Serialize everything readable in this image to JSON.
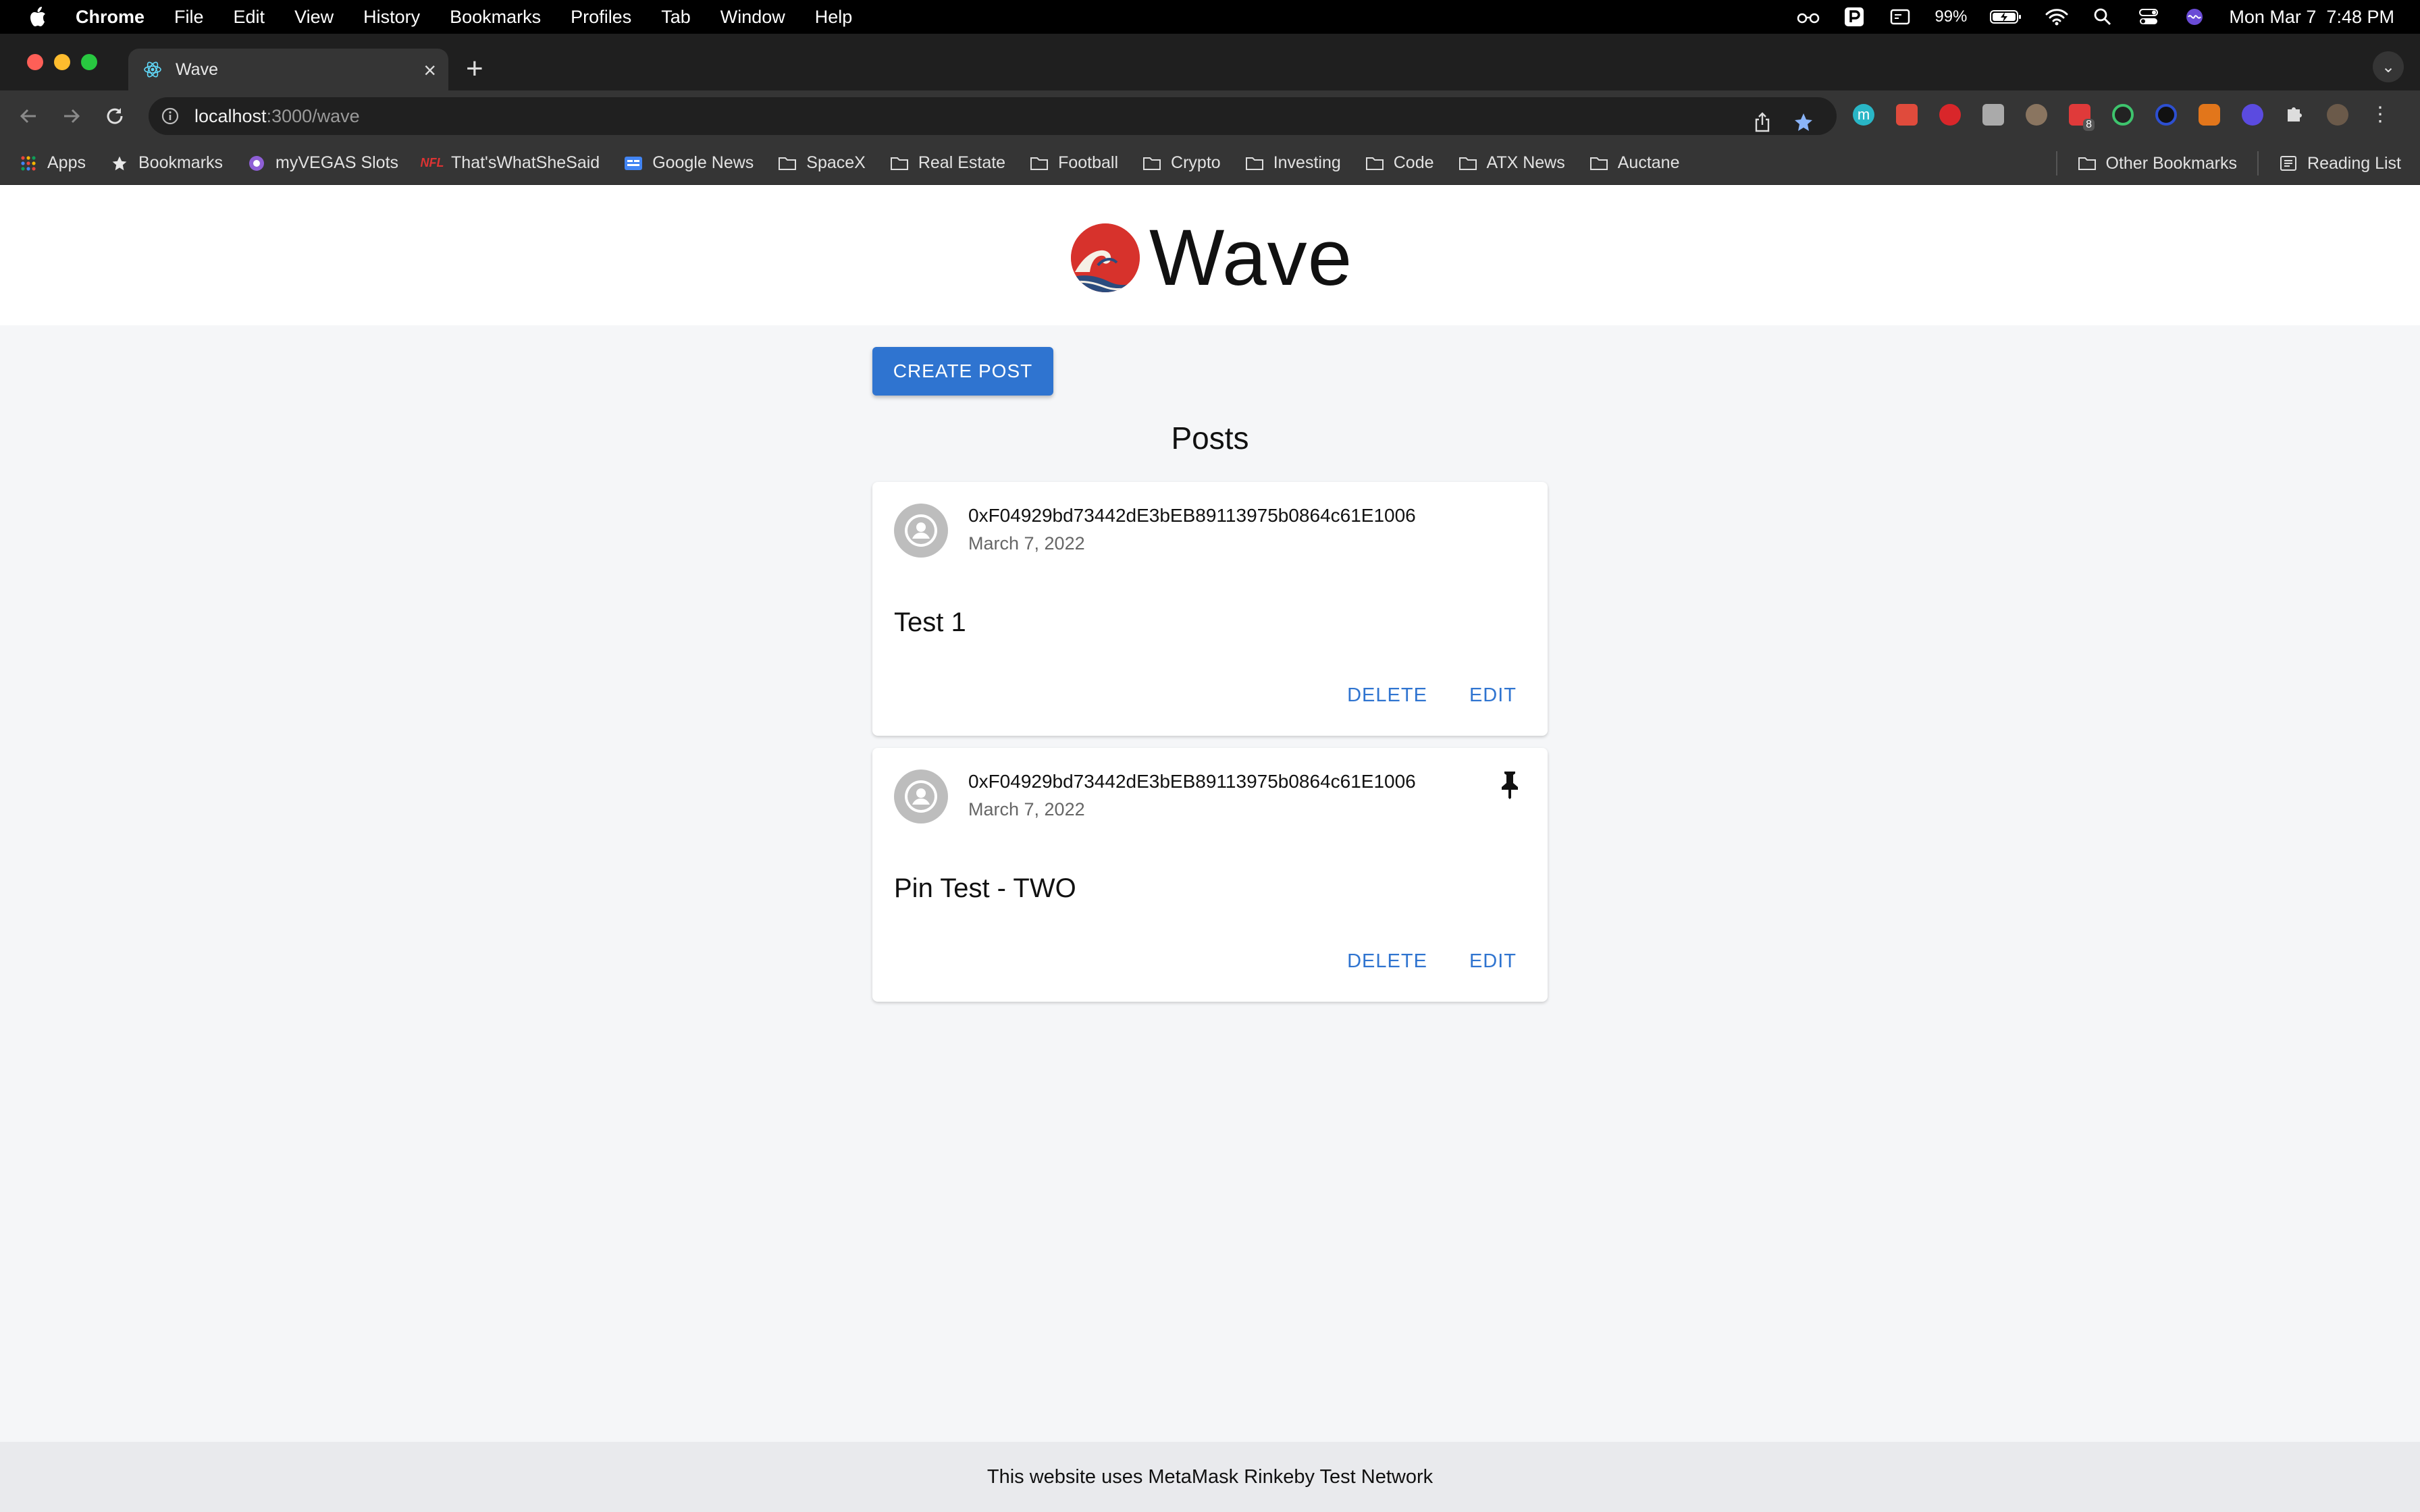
{
  "menubar": {
    "app": "Chrome",
    "items": [
      "File",
      "Edit",
      "View",
      "History",
      "Bookmarks",
      "Profiles",
      "Tab",
      "Window",
      "Help"
    ],
    "battery": "99%",
    "clock": "Mon Mar 7  7:48 PM"
  },
  "browser": {
    "tab_title": "Wave",
    "url_host": "localhost",
    "url_path": ":3000/wave",
    "bookmarks": [
      "Apps",
      "Bookmarks",
      "myVEGAS Slots",
      "That'sWhatSheSaid",
      "Google News",
      "SpaceX",
      "Real Estate",
      "Football",
      "Crypto",
      "Investing",
      "Code",
      "ATX News",
      "Auctane"
    ],
    "other_bookmarks": "Other Bookmarks",
    "reading_list": "Reading List",
    "extension_badge": "8"
  },
  "page": {
    "title": "Wave",
    "create_button": "CREATE POST",
    "posts_heading": "Posts",
    "posts": [
      {
        "author": "0xF04929bd73442dE3bEB89113975b0864c61E1006",
        "date": "March 7, 2022",
        "content": "Test 1",
        "pinned": false,
        "delete_label": "DELETE",
        "edit_label": "EDIT"
      },
      {
        "author": "0xF04929bd73442dE3bEB89113975b0864c61E1006",
        "date": "March 7, 2022",
        "content": "Pin Test - TWO",
        "pinned": true,
        "delete_label": "DELETE",
        "edit_label": "EDIT"
      }
    ],
    "footer": "This website uses MetaMask Rinkeby Test Network"
  },
  "colors": {
    "accent": "#2f74d0",
    "logo_red": "#d7322c"
  }
}
